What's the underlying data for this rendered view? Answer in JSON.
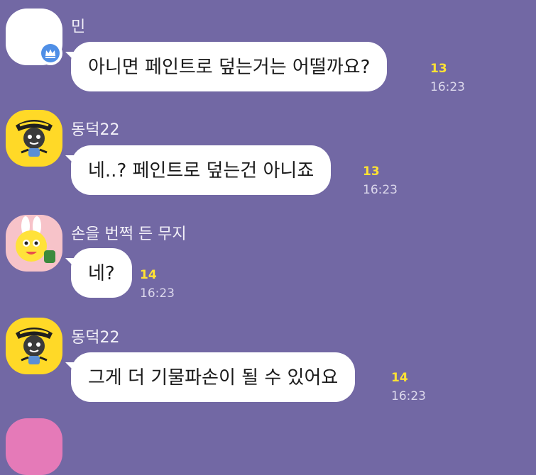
{
  "messages": [
    {
      "sender": "민",
      "text": "아니면 페인트로 덮는거는 어떨까요?",
      "unread": "13",
      "time": "16:23"
    },
    {
      "sender": "동덕22",
      "text": "네..? 페인트로 덮는건 아니죠",
      "unread": "13",
      "time": "16:23"
    },
    {
      "sender": "손을 번쩍 든 무지",
      "text": "네?",
      "unread": "14",
      "time": "16:23"
    },
    {
      "sender": "동덕22",
      "text": "그게 더 기물파손이 될 수 있어요",
      "unread": "14",
      "time": "16:23"
    }
  ],
  "colors": {
    "background": "#7268a4",
    "bubble": "#ffffff",
    "unread": "#ffe234",
    "host_badge": "#4f8fe6"
  },
  "icons": {
    "host_badge": "crown-icon",
    "avatar_2": "friday-character-avatar",
    "avatar_3": "muzi-character-avatar",
    "avatar_4": "friday-character-avatar"
  }
}
